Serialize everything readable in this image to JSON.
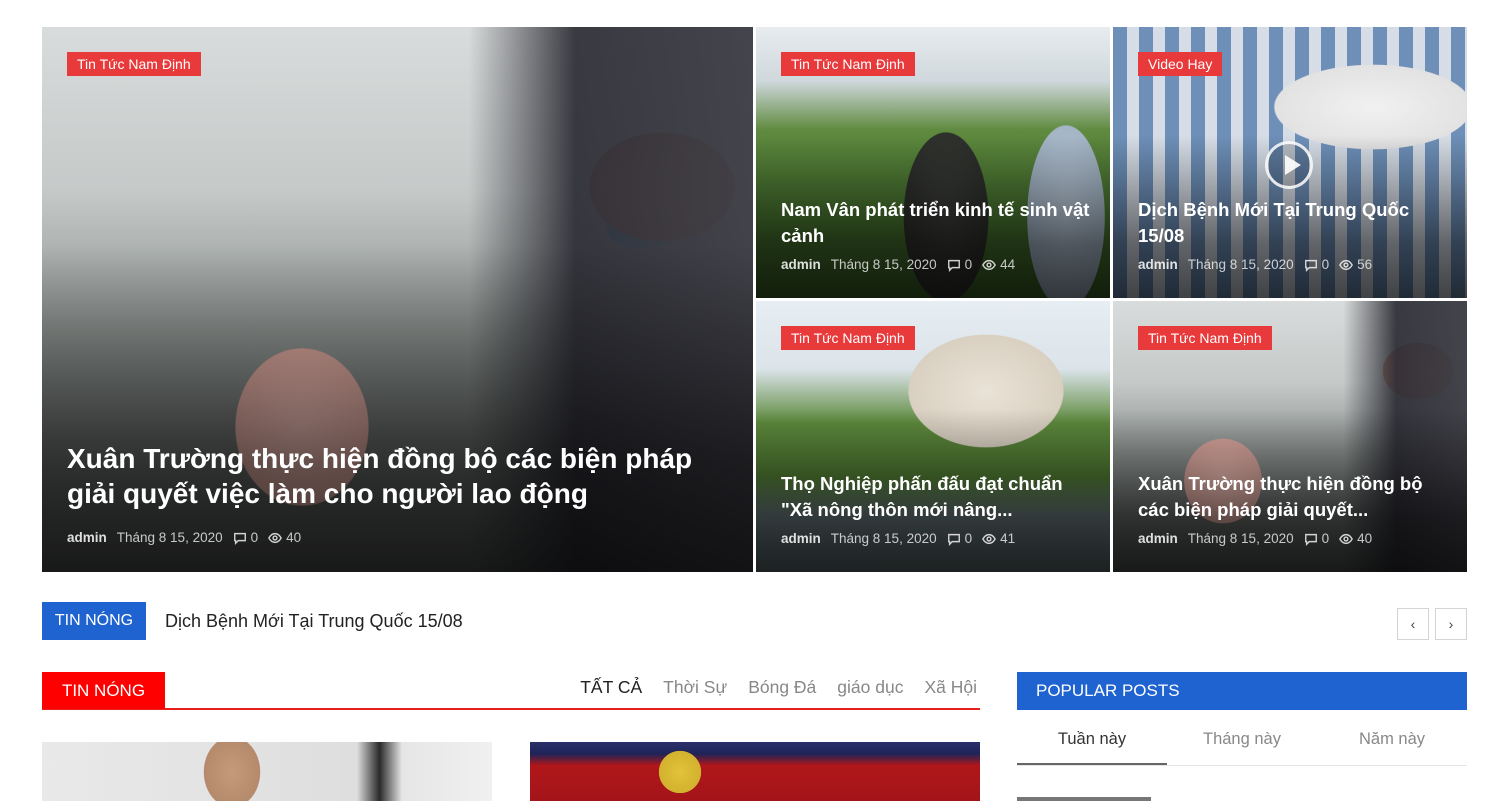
{
  "hero": {
    "main": {
      "category": "Tin Tức Nam Định",
      "title": "Xuân Trường thực hiện đồng bộ các biện pháp giải quyết việc làm cho người lao động",
      "author": "admin",
      "date": "Tháng 8 15, 2020",
      "comments": "0",
      "views": "40"
    },
    "cards": [
      {
        "category": "Tin Tức Nam Định",
        "title": "Nam Vân phát triển kinh tế sinh vật cảnh",
        "author": "admin",
        "date": "Tháng 8 15, 2020",
        "comments": "0",
        "views": "44"
      },
      {
        "category": "Video Hay",
        "title": "Dịch Bệnh Mới Tại Trung Quốc 15/08",
        "author": "admin",
        "date": "Tháng 8 15, 2020",
        "comments": "0",
        "views": "56"
      },
      {
        "category": "Tin Tức Nam Định",
        "title": "Thọ Nghiệp phấn đấu đạt chuẩn \"Xã nông thôn mới nâng...",
        "author": "admin",
        "date": "Tháng 8 15, 2020",
        "comments": "0",
        "views": "41"
      },
      {
        "category": "Tin Tức Nam Định",
        "title": "Xuân Trường thực hiện đồng bộ các biện pháp giải quyết...",
        "author": "admin",
        "date": "Tháng 8 15, 2020",
        "comments": "0",
        "views": "40"
      }
    ]
  },
  "ticker": {
    "label": "TIN NÓNG",
    "headline": "Dịch Bệnh Mới Tại Trung Quốc 15/08",
    "prev": "‹",
    "next": "›"
  },
  "section": {
    "title": "TIN NÓNG",
    "tabs": [
      "TẤT CẢ",
      "Thời Sự",
      "Bóng Đá",
      "giáo dục",
      "Xã Hội"
    ]
  },
  "popular": {
    "title": "POPULAR POSTS",
    "tabs": [
      "Tuần này",
      "Tháng này",
      "Năm này"
    ]
  },
  "colors": {
    "category_badge": "#e8393b",
    "accent_blue": "#1f63d1",
    "accent_red": "#ff0000"
  },
  "icons": {
    "comment": "comment-icon",
    "views": "eye-icon",
    "play": "play-icon"
  }
}
